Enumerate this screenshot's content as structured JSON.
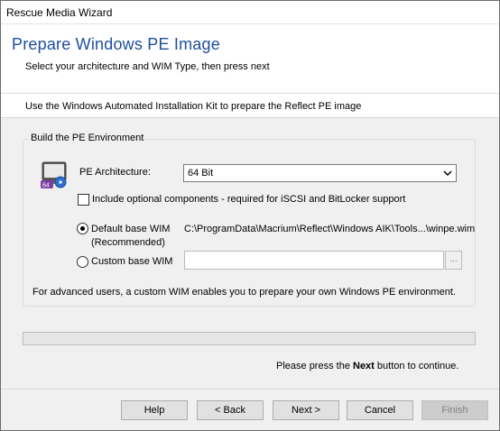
{
  "window": {
    "title": "Rescue Media Wizard"
  },
  "header": {
    "title": "Prepare Windows PE Image",
    "subtitle": "Select your architecture and WIM Type, then press next"
  },
  "info": {
    "text": "Use the Windows Automated Installation Kit to prepare the Reflect PE image"
  },
  "group": {
    "legend": "Build the PE Environment",
    "icon_badge": "64",
    "arch_label": "PE Architecture:",
    "arch_value": "64 Bit",
    "optional_label": "Include optional components - required for iSCSI and BitLocker support",
    "optional_checked": false,
    "default_wim_label_1": "Default base WIM",
    "default_wim_label_2": "(Recommended)",
    "default_wim_path": "C:\\ProgramData\\Macrium\\Reflect\\Windows AIK\\Tools...\\winpe.wim",
    "default_wim_selected": true,
    "custom_wim_label": "Custom base WIM",
    "custom_wim_value": "",
    "browse_label": "...",
    "advanced_note": "For advanced users, a custom WIM enables you to prepare your own Windows PE environment."
  },
  "progress": {
    "value": 0
  },
  "footer": {
    "next_prefix": "Please press the",
    "next_word": "Next",
    "next_suffix": "button to continue."
  },
  "buttons": {
    "help": "Help",
    "back": "< Back",
    "next": "Next >",
    "cancel": "Cancel",
    "finish": "Finish"
  }
}
